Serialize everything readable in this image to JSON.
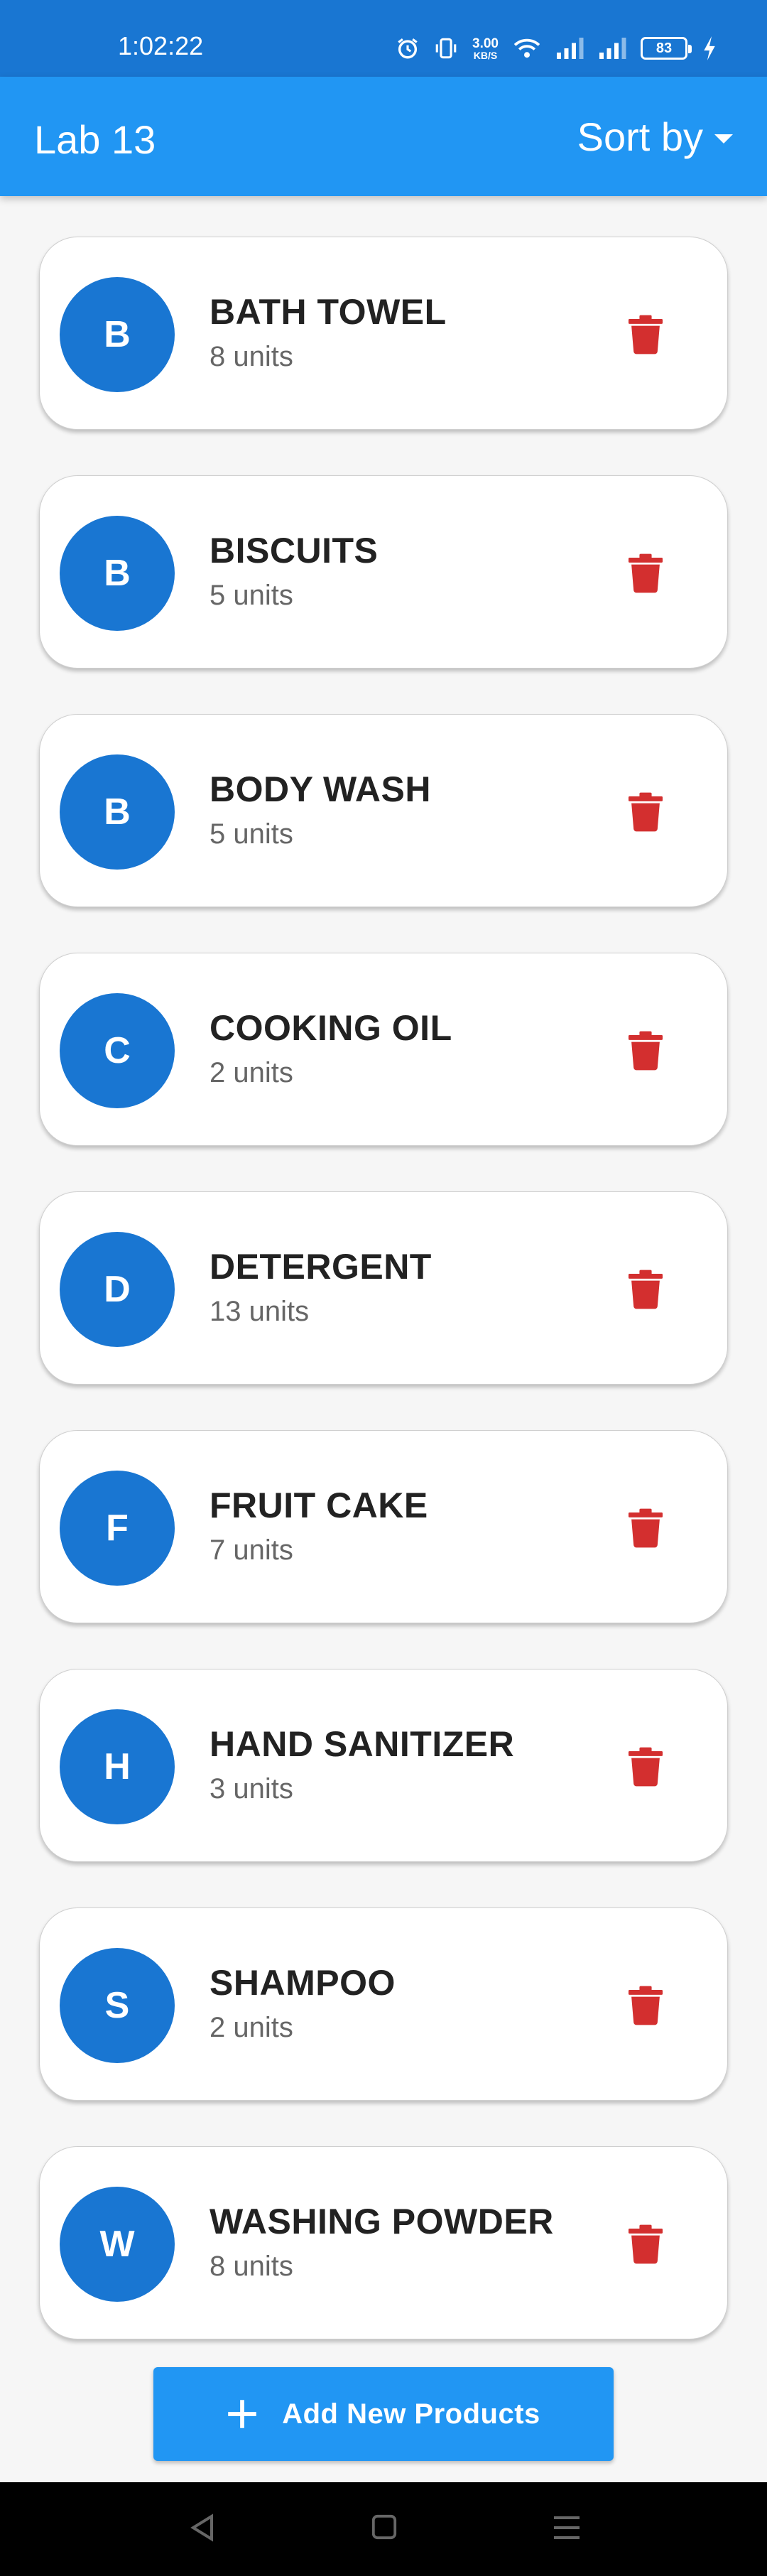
{
  "status_bar": {
    "time": "1:02:22",
    "net_speed_value": "3.00",
    "net_speed_unit": "KB/S",
    "battery_level": "83",
    "icons": [
      "alarm-icon",
      "vibrate-icon",
      "wifi-icon",
      "signal-icon",
      "signal-icon",
      "battery-icon",
      "charging-icon"
    ]
  },
  "app_bar": {
    "title": "Lab 13",
    "sort_label": "Sort by"
  },
  "products": [
    {
      "initial": "B",
      "name": "BATH TOWEL",
      "quantity": "8 units"
    },
    {
      "initial": "B",
      "name": "BISCUITS",
      "quantity": "5 units"
    },
    {
      "initial": "B",
      "name": "BODY WASH",
      "quantity": "5 units"
    },
    {
      "initial": "C",
      "name": "COOKING OIL",
      "quantity": "2 units"
    },
    {
      "initial": "D",
      "name": "DETERGENT",
      "quantity": "13 units"
    },
    {
      "initial": "F",
      "name": "FRUIT CAKE",
      "quantity": "7 units"
    },
    {
      "initial": "H",
      "name": "HAND SANITIZER",
      "quantity": "3 units"
    },
    {
      "initial": "S",
      "name": "SHAMPOO",
      "quantity": "2 units"
    },
    {
      "initial": "W",
      "name": "WASHING POWDER",
      "quantity": "8 units"
    }
  ],
  "add_button": {
    "label": "Add New Products",
    "icon": "plus-icon"
  },
  "colors": {
    "primary": "#2196f3",
    "status_bar": "#1976d2",
    "avatar": "#1976d2",
    "delete": "#d32f2f",
    "background": "#f6f6f6"
  }
}
